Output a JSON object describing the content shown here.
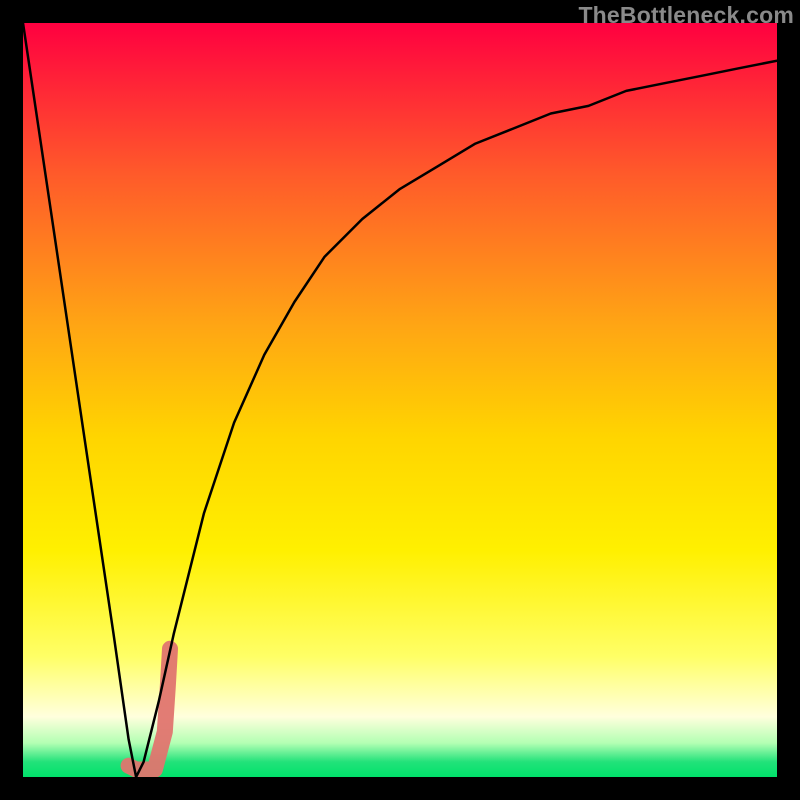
{
  "watermark": {
    "text": "TheBottleneck.com"
  },
  "chart_data": {
    "type": "line",
    "title": "",
    "xlabel": "",
    "ylabel": "",
    "xlim": [
      0,
      100
    ],
    "ylim": [
      0,
      100
    ],
    "grid": false,
    "legend": null,
    "series": [
      {
        "name": "bottleneck-curve",
        "x": [
          0,
          4,
          8,
          12,
          14,
          15,
          16,
          18,
          20,
          24,
          28,
          32,
          36,
          40,
          45,
          50,
          55,
          60,
          65,
          70,
          75,
          80,
          85,
          90,
          95,
          100
        ],
        "values": [
          100,
          73,
          46,
          19,
          5,
          0,
          2,
          10,
          19,
          35,
          47,
          56,
          63,
          69,
          74,
          78,
          81,
          84,
          86,
          88,
          89,
          91,
          92,
          93,
          94,
          95
        ]
      },
      {
        "name": "recommended-range-overlay",
        "x": [
          14.0,
          15.0,
          17.5,
          18.8,
          19.2,
          19.5
        ],
        "values": [
          1.5,
          1.0,
          1.0,
          6.0,
          12.0,
          17.0
        ]
      }
    ],
    "background_gradient_stops": [
      {
        "offset": 0.0,
        "color": "#ff0040"
      },
      {
        "offset": 0.2,
        "color": "#ff5a2a"
      },
      {
        "offset": 0.4,
        "color": "#ffa514"
      },
      {
        "offset": 0.55,
        "color": "#ffd500"
      },
      {
        "offset": 0.7,
        "color": "#fff000"
      },
      {
        "offset": 0.84,
        "color": "#ffff66"
      },
      {
        "offset": 0.92,
        "color": "#ffffdd"
      },
      {
        "offset": 0.955,
        "color": "#b3ffb3"
      },
      {
        "offset": 0.98,
        "color": "#22e27a"
      },
      {
        "offset": 1.0,
        "color": "#00e16b"
      }
    ]
  }
}
